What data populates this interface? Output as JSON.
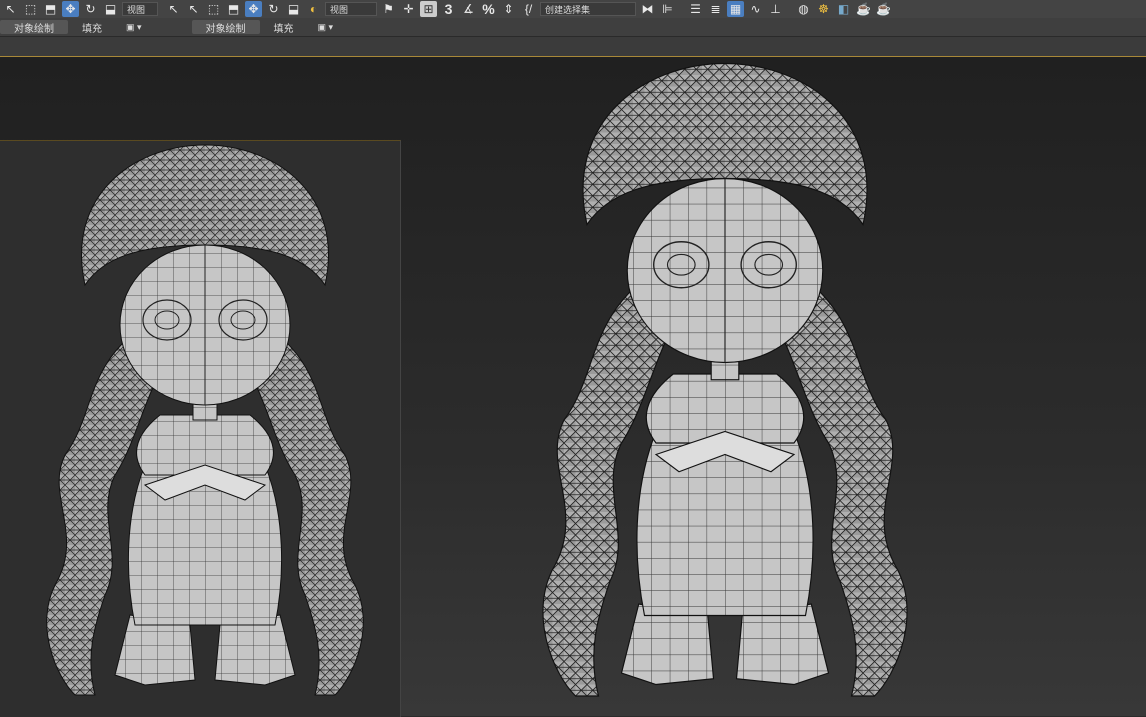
{
  "toolbar": {
    "view_dropdown_1": "视图",
    "view_dropdown_2": "视图",
    "selection_set_dropdown": "创建选择集",
    "snap_3_label": "3",
    "percent_label": "%"
  },
  "ribbon": {
    "tabs_left": [
      "对象绘制",
      "填充"
    ],
    "tabs_right": [
      "对象绘制",
      "填充"
    ]
  },
  "colors": {
    "accent": "#4a7ec0",
    "viewport_border": "#a88838",
    "mesh_fill": "#b8b8b8",
    "wire": "#1a1a1a"
  }
}
